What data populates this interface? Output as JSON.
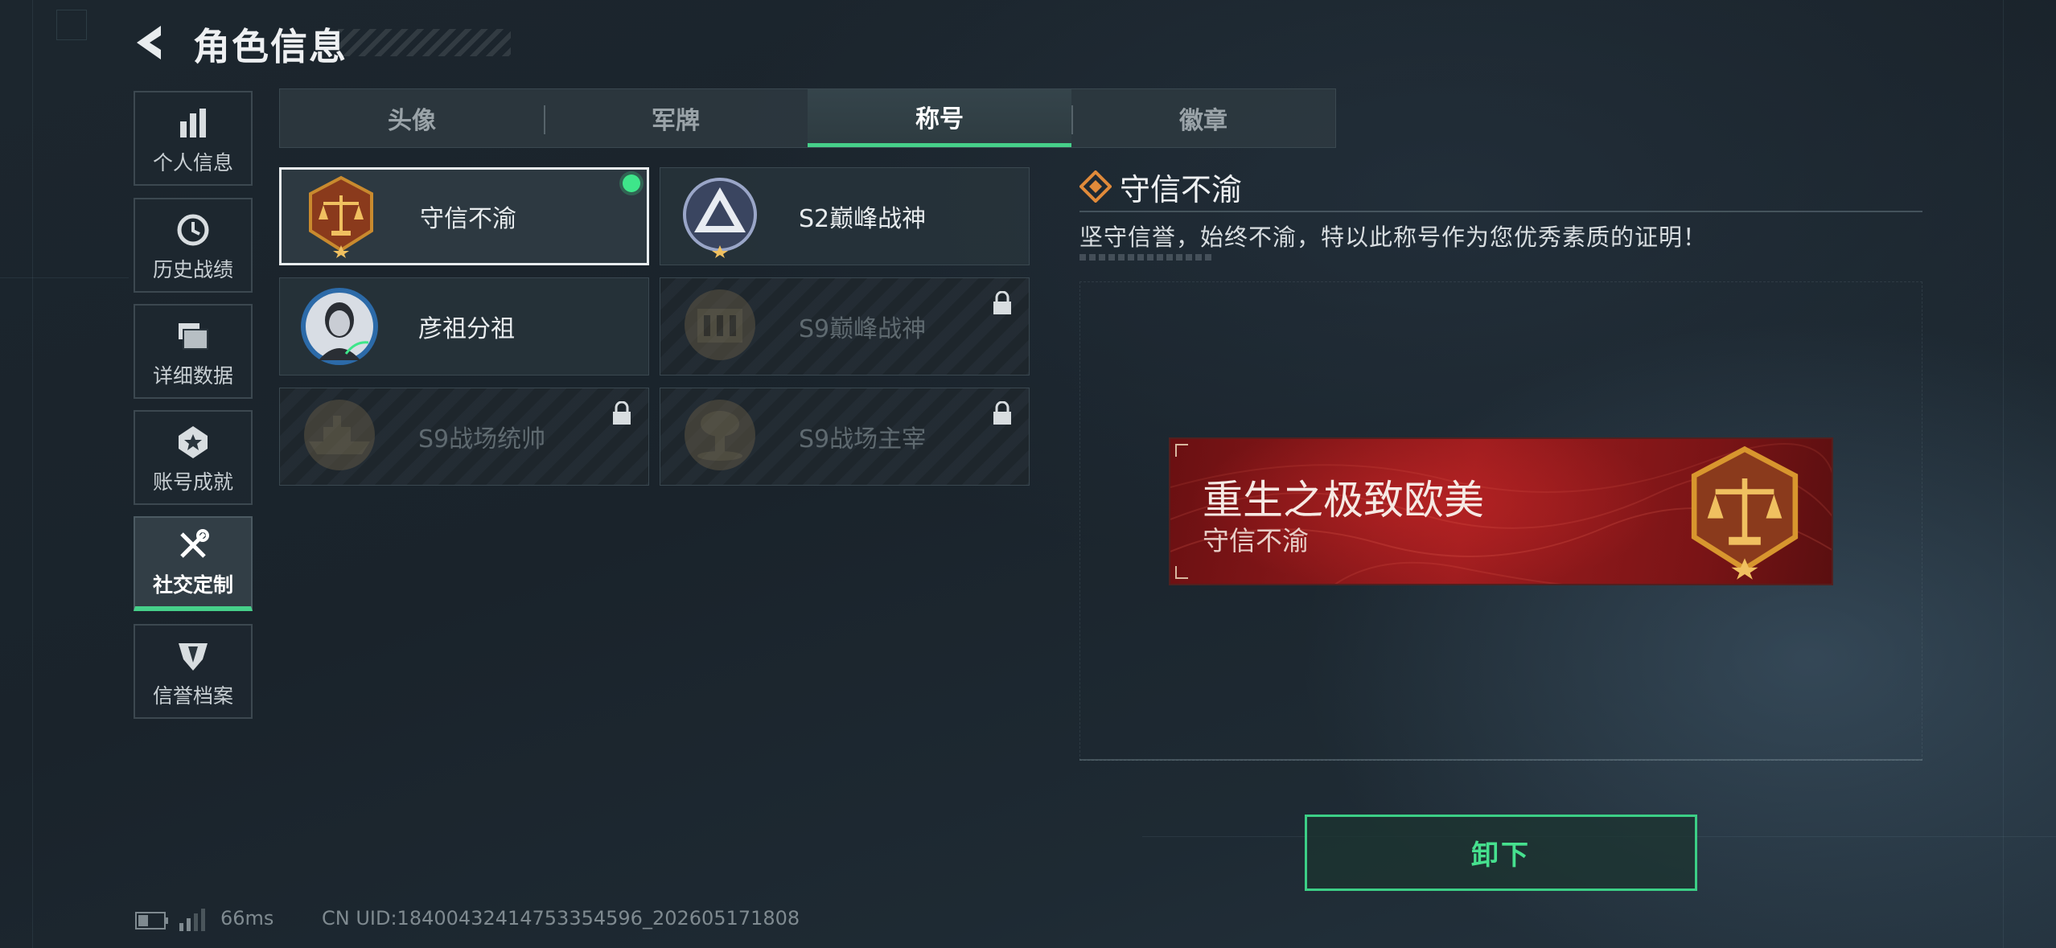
{
  "header": {
    "title": "角色信息"
  },
  "sidebar": {
    "items": [
      {
        "label": "个人信息",
        "icon": "bar-chart-icon"
      },
      {
        "label": "历史战绩",
        "icon": "clock-history-icon"
      },
      {
        "label": "详细数据",
        "icon": "folders-icon"
      },
      {
        "label": "账号成就",
        "icon": "achievement-badge-icon"
      },
      {
        "label": "社交定制",
        "icon": "wrench-screwdriver-icon",
        "active": true
      },
      {
        "label": "信誉档案",
        "icon": "shield-wing-icon"
      }
    ]
  },
  "tabs": [
    {
      "label": "头像"
    },
    {
      "label": "军牌"
    },
    {
      "label": "称号",
      "active": true
    },
    {
      "label": "徽章"
    }
  ],
  "titles": [
    {
      "name": "守信不渝",
      "emblem": "scales-emblem-icon",
      "selected": true,
      "equipped": true,
      "locked": false
    },
    {
      "name": "S2巅峰战神",
      "emblem": "triangle-emblem-icon",
      "locked": false
    },
    {
      "name": "彦祖分祖",
      "emblem": "portrait-emblem-icon",
      "locked": false
    },
    {
      "name": "S9巅峰战神",
      "emblem": "building-emblem-icon",
      "locked": true
    },
    {
      "name": "S9战场统帅",
      "emblem": "warship-emblem-icon",
      "locked": true
    },
    {
      "name": "S9战场主宰",
      "emblem": "mushroom-cloud-emblem-icon",
      "locked": true
    }
  ],
  "detail": {
    "title": "守信不渝",
    "description": "坚守信誉，始终不渝，特以此称号作为您优秀素质的证明！",
    "banner": {
      "main_text": "重生之极致欧美",
      "sub_text": "守信不渝"
    },
    "action_label": "卸下"
  },
  "status": {
    "ping": "66ms",
    "uid": "CN UID:18400432414753354596_202605171808"
  },
  "colors": {
    "accent": "#46d08a",
    "banner_red": "#9c1c1e",
    "emblem_gold": "#c98a2e"
  }
}
